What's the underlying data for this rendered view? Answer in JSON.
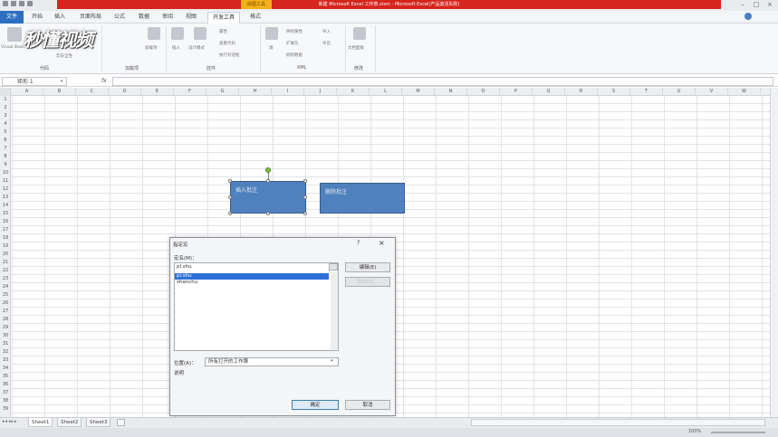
{
  "window": {
    "title": "新建 Microsoft Excel 工作表.xlsm - Microsoft Excel(产品激活失败)",
    "context_tab_group": "绘图工具",
    "buttons": [
      "–",
      "□",
      "×"
    ]
  },
  "ribbon_tabs": [
    "文件",
    "开始",
    "插入",
    "页面布局",
    "公式",
    "数据",
    "审阅",
    "视图",
    "开发工具",
    "格式"
  ],
  "ribbon": {
    "groups": [
      "代码",
      "加载项",
      "控件",
      "XML",
      "修改"
    ],
    "items": {
      "visual_basic": "Visual Basic",
      "macro_security": "宏安全性",
      "addins": "加载项",
      "insert": "插入",
      "design_mode": "设计模式",
      "properties": "属性",
      "view_code": "查看代码",
      "run_dialog": "执行对话框",
      "source": "源",
      "map_properties": "映射属性",
      "expansion_packs": "扩展包",
      "refresh_data": "刷新数据",
      "import": "导入",
      "export": "导出",
      "document_panel": "文档面板"
    }
  },
  "watermark": "秒懂视频",
  "formula_bar": {
    "name_box": "矩形 1",
    "fx": "fx",
    "value": ""
  },
  "columns": [
    "A",
    "B",
    "C",
    "D",
    "E",
    "F",
    "G",
    "H",
    "I",
    "J",
    "K",
    "L",
    "M",
    "N",
    "O",
    "P",
    "Q",
    "R",
    "S",
    "T",
    "U",
    "V",
    "W"
  ],
  "rows": [
    "1",
    "2",
    "3",
    "4",
    "5",
    "6",
    "7",
    "8",
    "9",
    "10",
    "11",
    "12",
    "13",
    "14",
    "15",
    "16",
    "17",
    "18",
    "19",
    "20",
    "21",
    "22",
    "23",
    "24",
    "25",
    "26",
    "27",
    "28",
    "29",
    "30",
    "31",
    "32",
    "33",
    "34",
    "35",
    "36",
    "37",
    "38",
    "39"
  ],
  "shapes": [
    {
      "label": "插入批注",
      "selected": true
    },
    {
      "label": "删除批注",
      "selected": false
    }
  ],
  "dialog": {
    "title": "指定宏",
    "help": "?",
    "close": "×",
    "macro_name_label": "宏名(M)：",
    "macro_name_value": "pl.shu",
    "macros": [
      "pl.shu",
      "shanchu"
    ],
    "edit_button": "编辑(E)",
    "record_button": "录制(R)...",
    "location_label": "位置(A)：",
    "location_value": "所有打开的工作簿",
    "description_label": "说明",
    "ok_button": "确定",
    "cancel_button": "取消"
  },
  "sheets": [
    "Sheet1",
    "Sheet2",
    "Sheet3"
  ],
  "status": {
    "zoom": "100%"
  },
  "colors": {
    "title_red": "#d6251c",
    "file_tab_blue": "#2c6fc0",
    "shape_fill": "#4f81bd",
    "selection": "#2f6fd6"
  }
}
